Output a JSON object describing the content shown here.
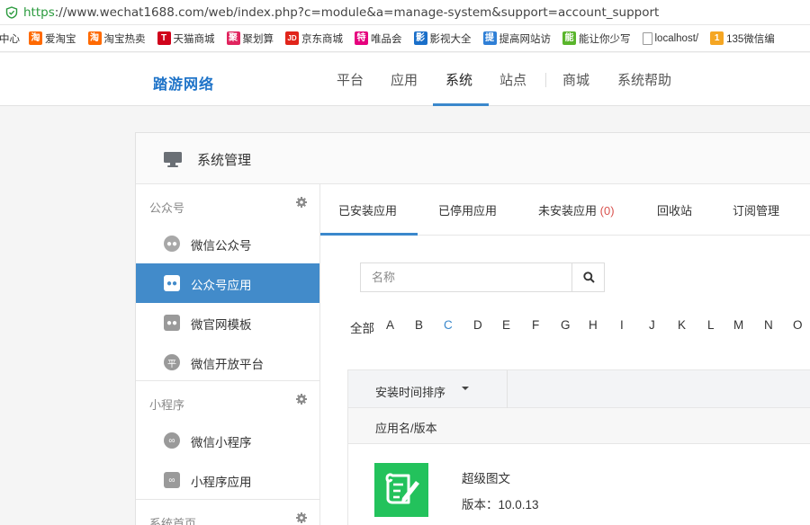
{
  "browser": {
    "url_scheme": "https",
    "url_rest": "://www.wechat1688.com/web/index.php?c=module&a=manage-system&support=account_support"
  },
  "bookmarks": [
    {
      "label": "中心",
      "color": "",
      "glyph": ""
    },
    {
      "label": "爱淘宝",
      "color": "#ff6a00",
      "glyph": "淘"
    },
    {
      "label": "淘宝热卖",
      "color": "#ff6a00",
      "glyph": "淘"
    },
    {
      "label": "天猫商城",
      "color": "#d0021b",
      "glyph": "T"
    },
    {
      "label": "聚划算",
      "color": "#e0245e",
      "glyph": "聚"
    },
    {
      "label": "京东商城",
      "color": "#e1251b",
      "glyph": "JD"
    },
    {
      "label": "唯品会",
      "color": "#e6007e",
      "glyph": "特"
    },
    {
      "label": "影视大全",
      "color": "#1a6fc9",
      "glyph": "影"
    },
    {
      "label": "提高网站访",
      "color": "#2f7fd6",
      "glyph": "提"
    },
    {
      "label": "能让你少写",
      "color": "#5ab52c",
      "glyph": "能"
    },
    {
      "label": "localhost/",
      "color": "#ffffff",
      "glyph": ""
    },
    {
      "label": "135微信编",
      "color": "#f5a623",
      "glyph": "1"
    }
  ],
  "topnav": {
    "logo": "踏游网络",
    "items": [
      "平台",
      "应用",
      "系统",
      "站点",
      "商城",
      "系统帮助"
    ],
    "active": "系统"
  },
  "panel": {
    "title": "系统管理"
  },
  "sidebar": {
    "sections": [
      {
        "label": "公众号",
        "items": [
          {
            "label": "微信公众号",
            "icon": "wechat-icon"
          },
          {
            "label": "公众号应用",
            "icon": "wechat-app-icon",
            "active": true
          },
          {
            "label": "微官网模板",
            "icon": "template-icon"
          },
          {
            "label": "微信开放平台",
            "icon": "open-platform-icon"
          }
        ]
      },
      {
        "label": "小程序",
        "items": [
          {
            "label": "微信小程序",
            "icon": "miniprogram-icon"
          },
          {
            "label": "小程序应用",
            "icon": "miniprogram-app-icon"
          }
        ]
      },
      {
        "label": "系统首页",
        "items": []
      }
    ]
  },
  "tabs": {
    "items": [
      "已安装应用",
      "已停用应用",
      "未安装应用",
      "回收站",
      "订阅管理"
    ],
    "uninstalled_count": "(0)",
    "active": "已安装应用"
  },
  "search": {
    "placeholder": "名称",
    "value": ""
  },
  "letters": {
    "items": [
      "全部",
      "A",
      "B",
      "C",
      "D",
      "E",
      "F",
      "G",
      "H",
      "I",
      "J",
      "K",
      "L",
      "M",
      "N",
      "O"
    ],
    "active": "C"
  },
  "list": {
    "sort_label": "安装时间排序",
    "column_header": "应用名/版本",
    "apps": [
      {
        "name": "超级图文",
        "version": "版本：10.0.13"
      }
    ]
  },
  "colors": {
    "accent": "#428bca",
    "app_icon": "#23c25c",
    "count": "#d9534f"
  }
}
